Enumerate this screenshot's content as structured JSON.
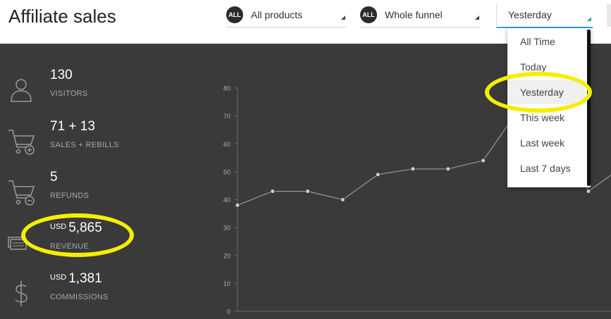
{
  "header": {
    "title": "Affiliate sales",
    "product_filter": {
      "badge": "ALL",
      "label": "All products"
    },
    "funnel_filter": {
      "badge": "ALL",
      "label": "Whole funnel"
    },
    "date_filter": {
      "label": "Yesterday"
    }
  },
  "stats": [
    {
      "value": "130",
      "label": "VISITORS",
      "icon": "person-icon"
    },
    {
      "value": "71 + 13",
      "label": "SALES + REBILLS",
      "icon": "cart-add-icon"
    },
    {
      "value": "5",
      "label": "REFUNDS",
      "icon": "cart-remove-icon"
    },
    {
      "currency": "USD",
      "value": "5,865",
      "label": "REVENUE",
      "icon": "money-icon"
    },
    {
      "currency": "USD",
      "value": "1,381",
      "label": "COMMISSIONS",
      "icon": "dollar-icon"
    }
  ],
  "date_menu": {
    "items": [
      "All Time",
      "Today",
      "Yesterday",
      "This week",
      "Last week",
      "Last 7 days"
    ],
    "selected": "Yesterday"
  },
  "chart_data": {
    "type": "line",
    "y_ticks": [
      "80",
      "70",
      "60",
      "50",
      "40",
      "30",
      "20",
      "10",
      "0"
    ],
    "ylim": [
      0,
      80
    ],
    "grid": false,
    "series": [
      {
        "values": [
          38,
          43,
          43,
          40,
          49,
          51,
          51,
          54,
          72,
          72,
          43,
          52
        ]
      }
    ]
  },
  "colors": {
    "panel_bg": "#3a3a3a",
    "highlight": "#f4ef00",
    "accent": "#36a3c9",
    "line": "#9a9a9a"
  }
}
